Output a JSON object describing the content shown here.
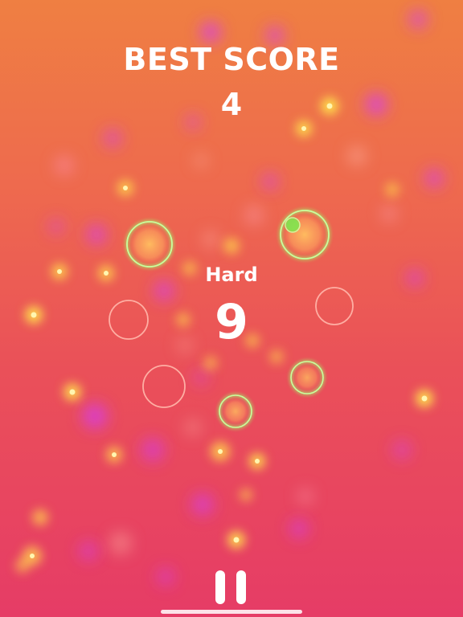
{
  "hud": {
    "best_label": "BEST SCORE",
    "best_value": "4",
    "difficulty": "Hard",
    "score": "9"
  },
  "colors": {
    "green_ring": "#9dff6a",
    "red_ring": "#ffb3a8",
    "glow_orange": "#ffc060",
    "yellow_particle": "#ffe44d",
    "magenta_particle": "#d63df0",
    "pink_particle": "#ff8fb0"
  },
  "icons": {
    "pause": "pause-icon"
  }
}
